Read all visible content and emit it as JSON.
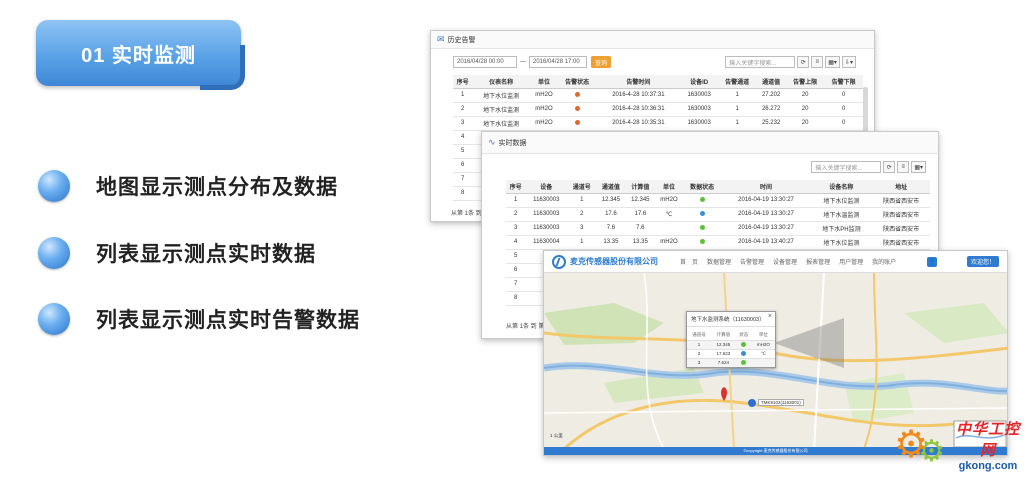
{
  "slide": {
    "title": "01  实时监测",
    "bullets": [
      "地图显示测点分布及数据",
      "列表显示测点实时数据",
      "列表显示测点实时告警数据"
    ]
  },
  "history_window": {
    "title": "历史告警",
    "start_date": "2016/04/28 00:00",
    "date_sep": "—",
    "end_date": "2016/04/28 17:00",
    "query_label": "查询",
    "search_placeholder": "输入关键字搜索...",
    "columns": [
      "序号",
      "仪表名称",
      "单位",
      "告警状态",
      "告警时间",
      "设备ID",
      "告警通道",
      "通道值",
      "告警上限",
      "告警下限"
    ],
    "rows": [
      [
        "1",
        "地下水位监测",
        "mH2O",
        "",
        "2016-4-28 10:37:31",
        "1630003",
        "1",
        "27.202",
        "20",
        "0"
      ],
      [
        "2",
        "地下水位监测",
        "mH2O",
        "",
        "2016-4-28 10:36:31",
        "1630003",
        "1",
        "26.272",
        "20",
        "0"
      ],
      [
        "3",
        "地下水位监测",
        "mH2O",
        "",
        "2016-4-28 10:35:31",
        "1630003",
        "1",
        "25.232",
        "20",
        "0"
      ]
    ],
    "row_numbers_hidden": [
      "4",
      "5",
      "6",
      "7",
      "8"
    ],
    "footer": "从第 1条 到"
  },
  "realtime_window": {
    "title": "实时数据",
    "search_placeholder": "输入关键字搜索...",
    "columns": [
      "序号",
      "设备",
      "通道号",
      "通道值",
      "计算值",
      "单位",
      "数据状态",
      "时间",
      "设备名称",
      "地址"
    ],
    "rows": [
      [
        "1",
        "11630003",
        "1",
        "12.345",
        "12.345",
        "mH2O",
        "green",
        "2016-04-19 13:30:27",
        "地下水位监测",
        "陕西省西安市"
      ],
      [
        "2",
        "11630003",
        "2",
        "17.6",
        "17.6",
        "℃",
        "blue",
        "2016-04-19 13:30:27",
        "地下水温监测",
        "陕西省西安市"
      ],
      [
        "3",
        "11630003",
        "3",
        "7.6",
        "7.6",
        "",
        "green",
        "2016-04-19 13:30:27",
        "地下水PH监测",
        "陕西省西安市"
      ],
      [
        "4",
        "11630004",
        "1",
        "13.35",
        "13.35",
        "mH2O",
        "green",
        "2016-04-19 13:40:27",
        "地下水位监测",
        "陕西省西安市"
      ]
    ],
    "partial_rows": [
      "5",
      "6",
      "7",
      "8"
    ],
    "partial_prefix": "11",
    "footer": "从第 1条 到 第"
  },
  "map_window": {
    "company": "麦克传感器股份有限公司",
    "nav": [
      "首　页",
      "数据管理",
      "告警管理",
      "设备管理",
      "报表管理",
      "用户管理",
      "我的账户"
    ],
    "welcome": "欢迎您！",
    "popup": {
      "title": "地下水监测系统（11630003）",
      "columns": [
        "通道号",
        "计算值",
        "状态",
        "单位"
      ],
      "rows": [
        [
          "1",
          "12.345",
          "green",
          "mH2O"
        ],
        [
          "2",
          "17.623",
          "blue",
          "℃"
        ],
        [
          "3",
          "7.624",
          "green",
          ""
        ]
      ]
    },
    "marker_label": "TMK9102(1163001)",
    "scale_label": "1 公里",
    "footer": "©copyright 麦克传感器股份有限公司"
  },
  "watermark": {
    "cn": "中华工控网",
    "url": "gkong.com"
  },
  "colors": {
    "accent": "#2f7bd1",
    "orange": "#f0a030",
    "status_green": "#5bbf3a",
    "status_blue": "#3a8ed8"
  }
}
